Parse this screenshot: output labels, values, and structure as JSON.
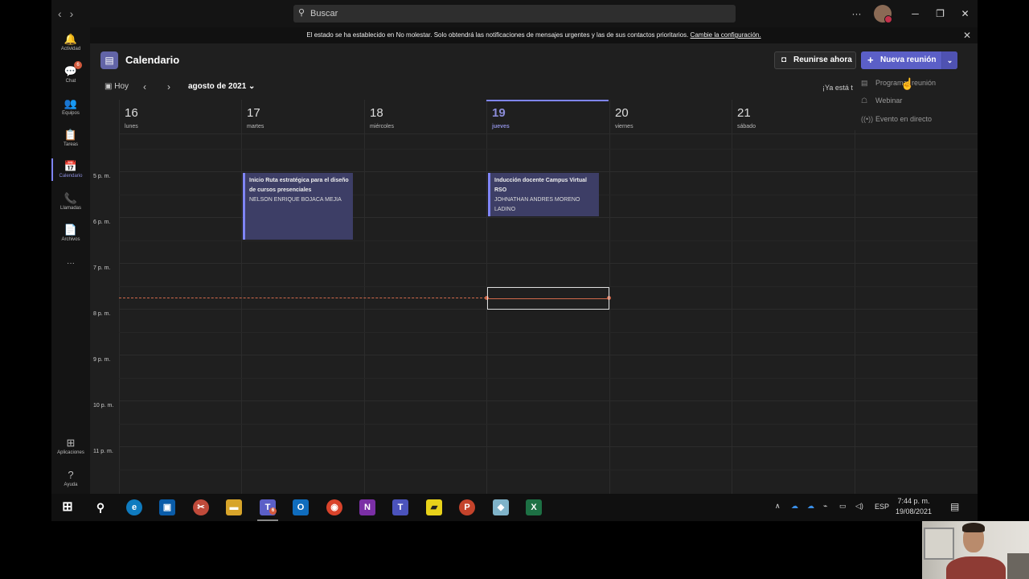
{
  "titlebar": {
    "search_placeholder": "Buscar",
    "back": "‹",
    "forward": "›",
    "more": "···",
    "minimize": "─",
    "maximize": "❐",
    "close": "✕"
  },
  "rail": {
    "items": [
      {
        "label": "Actividad",
        "icon": "🔔"
      },
      {
        "label": "Chat",
        "icon": "💬",
        "badge": "6"
      },
      {
        "label": "Equipos",
        "icon": "👥"
      },
      {
        "label": "Tareas",
        "icon": "📋"
      },
      {
        "label": "Calendario",
        "icon": "📅"
      },
      {
        "label": "Llamadas",
        "icon": "📞"
      },
      {
        "label": "Archivos",
        "icon": "📄"
      },
      {
        "label": "···",
        "icon": ""
      },
      {
        "label": "Aplicaciones",
        "icon": "⊞"
      },
      {
        "label": "Ayuda",
        "icon": "?"
      }
    ]
  },
  "banner": {
    "text": "El estado se ha establecido en No molestar. Solo obtendrá las notificaciones de mensajes urgentes y las de sus contactos prioritarios. ",
    "link": "Cambie la configuración."
  },
  "header": {
    "title": "Calendario",
    "meet_now": "Reunirse ahora",
    "new_meeting": "Nueva reunión",
    "today": "Hoy",
    "month": "agosto de 2021",
    "already_text": "¡Ya está t"
  },
  "dropdown": {
    "items": [
      "Programar reunión",
      "Webinar",
      "Evento en directo"
    ]
  },
  "days": [
    {
      "num": "16",
      "name": "lunes"
    },
    {
      "num": "17",
      "name": "martes"
    },
    {
      "num": "18",
      "name": "miércoles"
    },
    {
      "num": "19",
      "name": "jueves"
    },
    {
      "num": "20",
      "name": "viernes"
    },
    {
      "num": "21",
      "name": "sábado"
    }
  ],
  "hours": [
    "5 p. m.",
    "6 p. m.",
    "7 p. m.",
    "8 p. m.",
    "9 p. m.",
    "10 p. m.",
    "11 p. m."
  ],
  "events": [
    {
      "title": "Inicio Ruta estratégica para el diseño de cursos presenciales",
      "organizer": "NELSON ENRIQUE BOJACA MEJIA"
    },
    {
      "title": "Inducción docente Campus Virtual RSO",
      "organizer": "JOHNATHAN ANDRES MORENO LADINO"
    }
  ],
  "taskbar": {
    "lang": "ESP",
    "time": "7:44 p. m.",
    "date": "19/08/2021",
    "teams_badge": "6"
  }
}
